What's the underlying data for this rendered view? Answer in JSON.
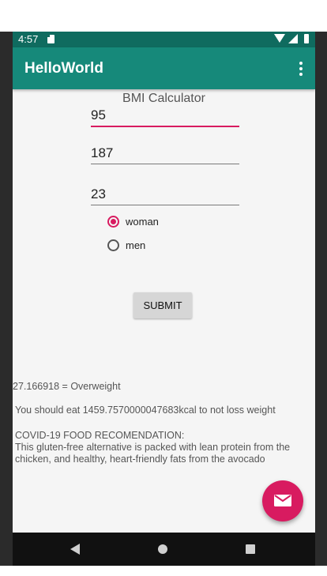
{
  "status_bar": {
    "time": "4:57",
    "icons": [
      "sd-card-icon",
      "wifi-icon",
      "signal-icon",
      "battery-icon"
    ]
  },
  "app_bar": {
    "title": "HelloWorld",
    "menu_icon": "overflow-menu-icon"
  },
  "form": {
    "heading": "BMI Calculator",
    "weight_value": "95",
    "height_value": "187",
    "age_value": "23",
    "gender_options": [
      {
        "label": "woman",
        "selected": true
      },
      {
        "label": "men",
        "selected": false
      }
    ],
    "submit_label": "SUBMIT"
  },
  "results": {
    "bmi_line": "27.166918 = Overweight",
    "calorie_line": "You should eat 1459.7570000047683kcal to not loss weight",
    "covid_title": "COVID-19 FOOD RECOMENDATION:",
    "covid_body": "This gluten-free alternative is packed with lean protein from the chicken, and healthy, heart-friendly fats from the avocado"
  },
  "fab": {
    "icon": "mail-icon"
  },
  "nav_bar": {
    "icons": [
      "back-icon",
      "home-icon",
      "recents-icon"
    ]
  },
  "colors": {
    "status_bar": "#0f6b5f",
    "app_bar": "#16897a",
    "accent": "#d81b60",
    "background": "#f5f5f5"
  }
}
